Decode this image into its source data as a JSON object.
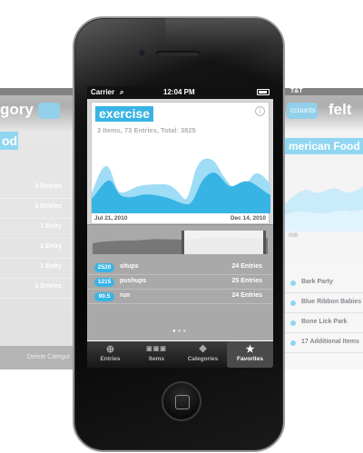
{
  "left_screen": {
    "title": "gory",
    "chip": "od",
    "rows": [
      "3 Entries",
      "3 Entries",
      "1 Entry",
      "1 Entry",
      "1 Entry",
      "3 Entries"
    ],
    "bottom_label": "Delete Categor"
  },
  "right_screen": {
    "status_text": "T&T",
    "back_label": "ccounts",
    "title": "felt",
    "chip": "merican Food",
    "date": "009",
    "rows": [
      "Bark Party",
      "Blue Ribbon Babies",
      "Bone Lick Park",
      "17 Additional Items"
    ]
  },
  "status_bar": {
    "carrier": "Carrier",
    "time": "12:04 PM"
  },
  "card": {
    "title": "exercise",
    "info_icon": "i",
    "summary": "3 Items, 73 Entries, Total: 3825",
    "date_start": "Jul 21, 2010",
    "date_end": "Dec 14, 2010"
  },
  "entries": [
    {
      "value": "2520",
      "name": "situps",
      "count": "24 Entries"
    },
    {
      "value": "1215",
      "name": "pushups",
      "count": "25 Entries"
    },
    {
      "value": "90.5",
      "name": "run",
      "count": "24 Entries"
    }
  ],
  "tabs": [
    {
      "label": "Entries",
      "icon": "plus-icon"
    },
    {
      "label": "Items",
      "icon": "abc-icon"
    },
    {
      "label": "Categories",
      "icon": "tags-icon"
    },
    {
      "label": "Favorites",
      "icon": "star-icon"
    }
  ],
  "colors": {
    "accent": "#38b4e4",
    "accent_light": "#9fdcf5"
  }
}
